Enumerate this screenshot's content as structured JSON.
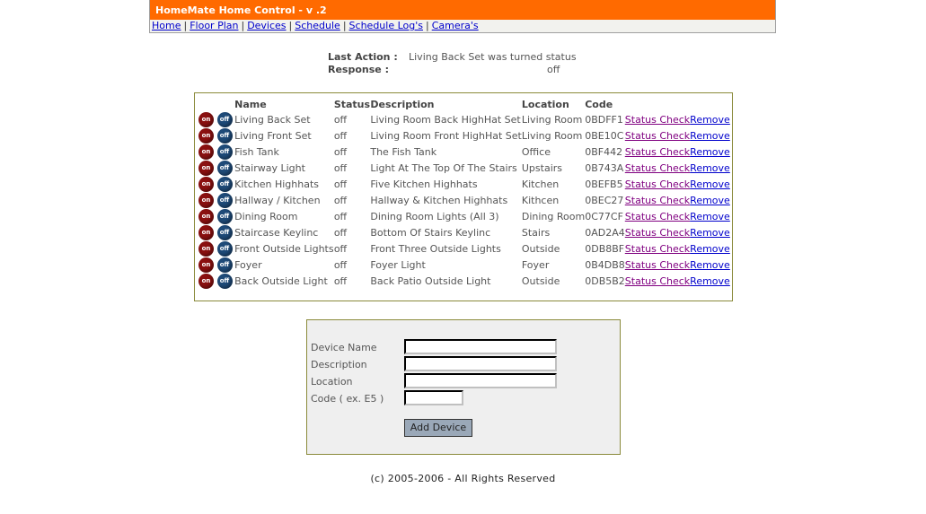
{
  "header": {
    "title": "HomeMate Home Control - v .2",
    "nav": [
      "Home",
      "Floor Plan",
      "Devices",
      "Schedule",
      "Schedule Log's",
      "Camera's"
    ]
  },
  "last_action": {
    "action_label": "Last Action :",
    "action_value": "Living Back Set was turned status",
    "response_label": "Response :",
    "response_value": "off"
  },
  "devices": {
    "headers": {
      "name": "Name",
      "status": "Status",
      "description": "Description",
      "location": "Location",
      "code": "Code"
    },
    "on_label": "on",
    "off_label": "off",
    "check_label": "Status Check",
    "remove_label": "Remove",
    "rows": [
      {
        "name": "Living Back Set",
        "status": "off",
        "description": "Living Room Back HighHat Set",
        "location": "Living Room",
        "code": "0BDFF1"
      },
      {
        "name": "Living Front Set",
        "status": "off",
        "description": "Living Room Front HighHat Set",
        "location": "Living Room",
        "code": "0BE10C"
      },
      {
        "name": "Fish Tank",
        "status": "off",
        "description": "The Fish Tank",
        "location": "Office",
        "code": "0BF442"
      },
      {
        "name": "Stairway Light",
        "status": "off",
        "description": "Light At The Top Of The Stairs",
        "location": "Upstairs",
        "code": "0B743A"
      },
      {
        "name": "Kitchen Highhats",
        "status": "off",
        "description": "Five Kitchen Highhats",
        "location": "Kitchen",
        "code": "0BEFB5"
      },
      {
        "name": "Hallway / Kitchen",
        "status": "off",
        "description": "Hallway & Kitchen Highhats",
        "location": "Kithcen",
        "code": "0BEC27"
      },
      {
        "name": "Dining Room",
        "status": "off",
        "description": "Dining Room Lights (All 3)",
        "location": "Dining Room",
        "code": "0C77CF"
      },
      {
        "name": "Staircase Keylinc",
        "status": "off",
        "description": "Bottom Of Stairs Keylinc",
        "location": "Stairs",
        "code": "0AD2A4"
      },
      {
        "name": "Front Outside Lights",
        "status": "off",
        "description": "Front Three Outside Lights",
        "location": "Outside",
        "code": "0DB8BF"
      },
      {
        "name": "Foyer",
        "status": "off",
        "description": "Foyer Light",
        "location": "Foyer",
        "code": "0B4DB8"
      },
      {
        "name": "Back Outside Light",
        "status": "off",
        "description": "Back Patio Outside Light",
        "location": "Outside",
        "code": "0DB5B2"
      }
    ]
  },
  "form": {
    "device_name_label": "Device Name",
    "description_label": "Description",
    "location_label": "Location",
    "code_label": "Code ( ex. E5 )",
    "device_name_value": "",
    "description_value": "",
    "location_value": "",
    "code_value": "",
    "add_label": "Add Device"
  },
  "footer": "(c) 2005-2006 - All Rights Reserved"
}
